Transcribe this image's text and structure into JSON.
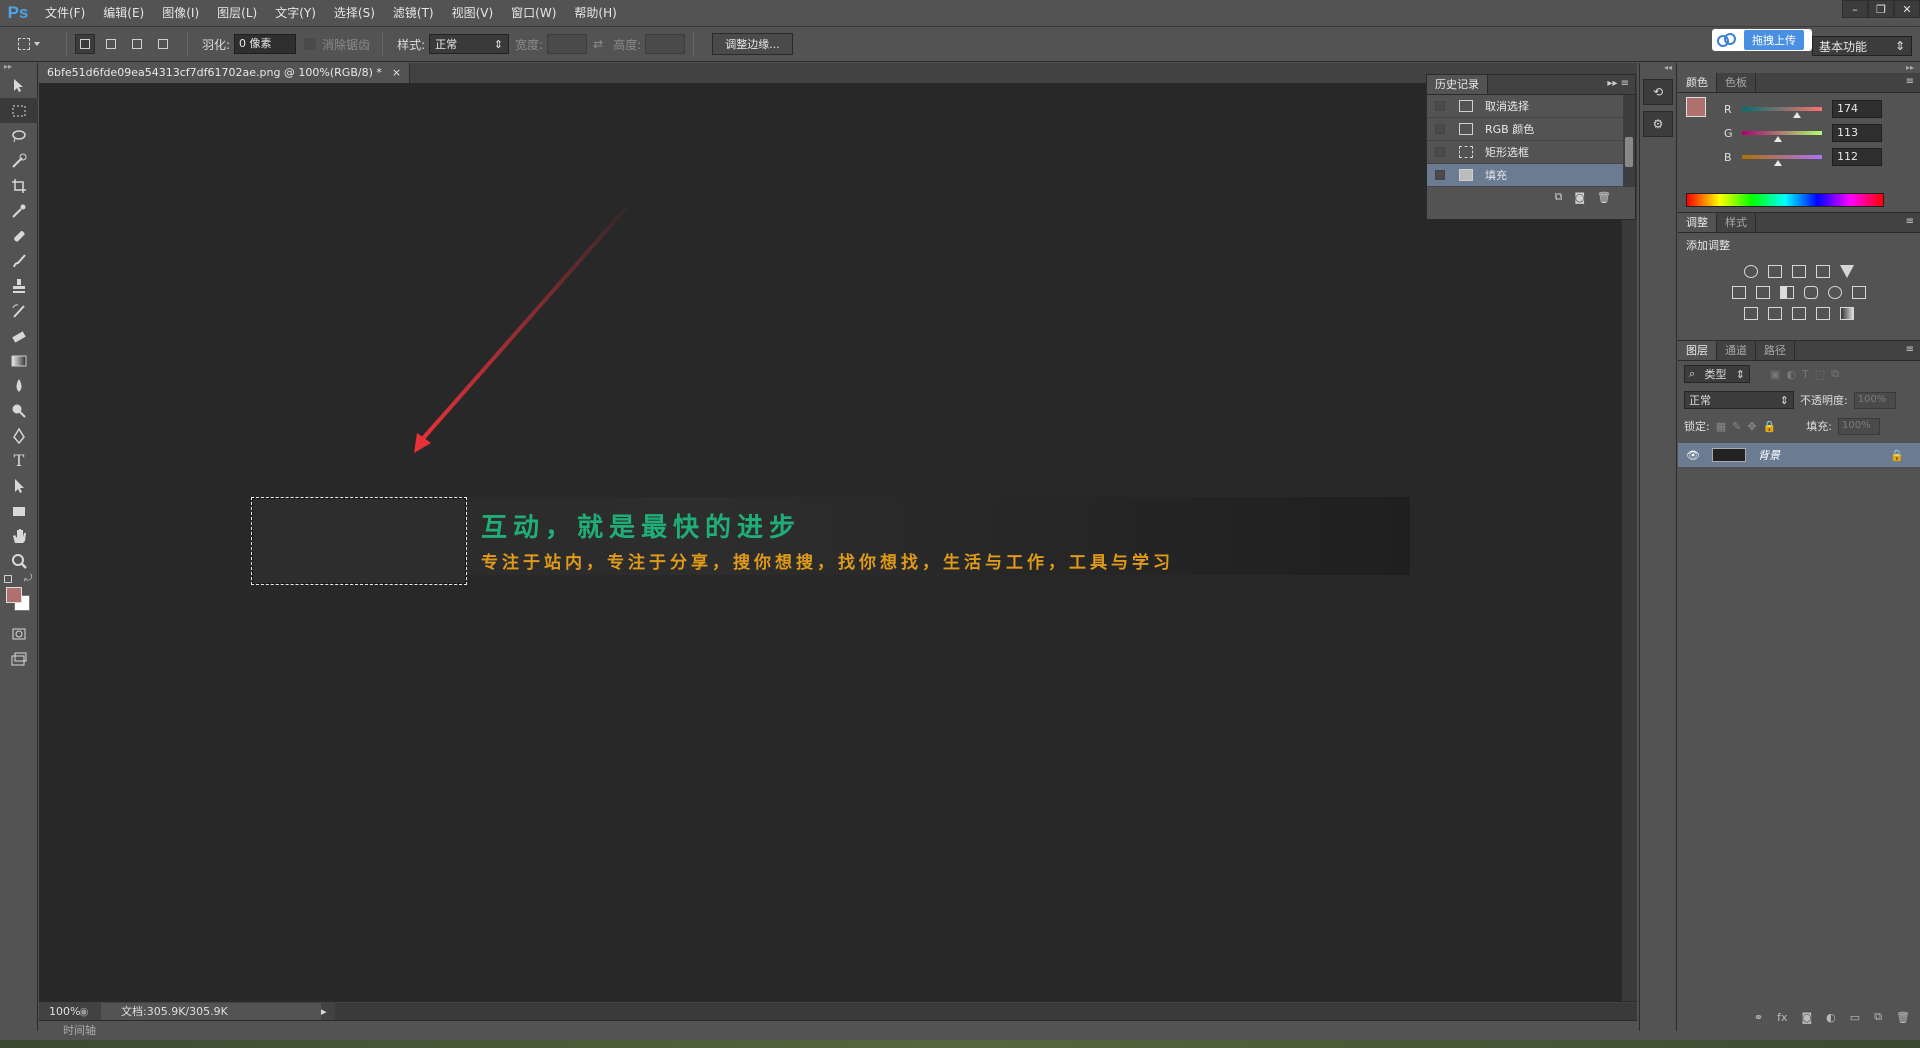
{
  "app": {
    "logo": "Ps",
    "menu": [
      "文件(F)",
      "编辑(E)",
      "图像(I)",
      "图层(L)",
      "文字(Y)",
      "选择(S)",
      "滤镜(T)",
      "视图(V)",
      "窗口(W)",
      "帮助(H)"
    ],
    "window_controls": [
      "–",
      "❐",
      "✕"
    ]
  },
  "options_bar": {
    "feather_label": "羽化:",
    "feather_value": "0 像素",
    "antialias_label": "消除锯齿",
    "style_label": "样式:",
    "style_value": "正常",
    "width_label": "宽度:",
    "height_label": "高度:",
    "refine_edge_button": "调整边缘...",
    "upload_badge": "拖拽上传",
    "workspace": "基本功能"
  },
  "document": {
    "tab_title": "6bfe51d6fde09ea54313cf7df61702ae.png @ 100%(RGB/8) *",
    "tab_close": "×",
    "banner_title": "互动，就是最快的进步",
    "banner_subtitle": "专注于站内，专注于分享，搜你想搜，找你想找，生活与工作，工具与学习"
  },
  "status": {
    "zoom": "100%",
    "doc_size": "文档:305.9K/305.9K",
    "timeline": "时间轴"
  },
  "history_panel": {
    "tab": "历史记录",
    "items": [
      {
        "label": "取消选择",
        "icon": "document-icon"
      },
      {
        "label": "RGB 颜色",
        "icon": "document-icon"
      },
      {
        "label": "矩形选框",
        "icon": "marquee-icon"
      },
      {
        "label": "填充",
        "icon": "fill-icon"
      }
    ],
    "selected_index": 3
  },
  "color_panel": {
    "tabs": [
      "颜色",
      "色板"
    ],
    "channels": [
      {
        "name": "R",
        "value": "174"
      },
      {
        "name": "G",
        "value": "113"
      },
      {
        "name": "B",
        "value": "112"
      }
    ],
    "foreground": "#ae7170",
    "background": "#ffffff"
  },
  "adjustments_panel": {
    "tabs": [
      "调整",
      "样式"
    ],
    "title": "添加调整"
  },
  "layers_panel": {
    "tabs": [
      "图层",
      "通道",
      "路径"
    ],
    "filter_label": "类型",
    "blend_mode": "正常",
    "opacity_label": "不透明度:",
    "opacity_value": "100%",
    "lock_label": "锁定:",
    "fill_label": "填充:",
    "fill_value": "100%",
    "layers": [
      {
        "name": "背景",
        "locked": true,
        "visible": true
      }
    ]
  },
  "colors": {
    "banner_title": "#1fae78",
    "banner_subtitle": "#e09a1a",
    "arrow": "#e8313a",
    "selection_highlight": "#6b7b92"
  }
}
